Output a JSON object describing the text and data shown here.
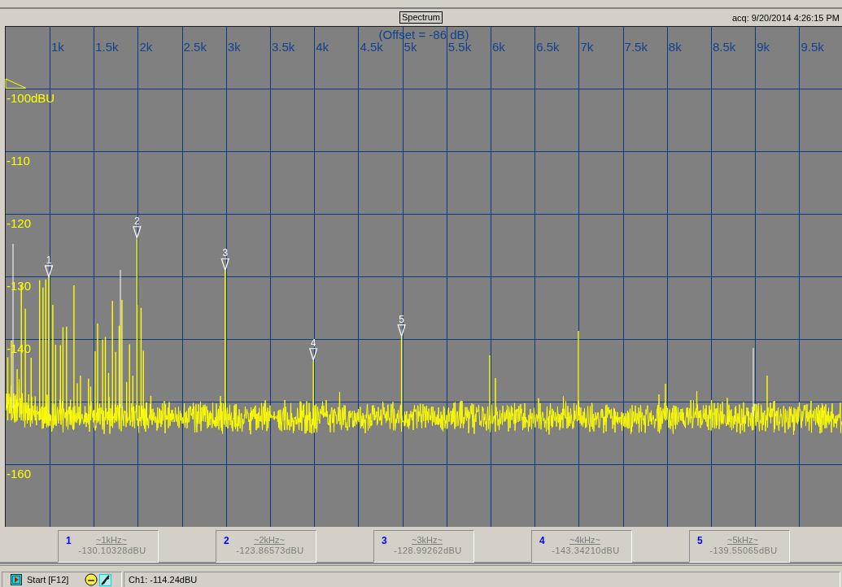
{
  "header": {
    "title": "Spectrum",
    "acquired": "acq: 9/20/2014 4:26:15 PM"
  },
  "plot": {
    "offset": "(Offset = -86 dB)",
    "x_ticks": [
      "1k",
      "1.5k",
      "2k",
      "2.5k",
      "3k",
      "3.5k",
      "4k",
      "4.5k",
      "5k",
      "5.5k",
      "6k",
      "6.5k",
      "7k",
      "7.5k",
      "8k",
      "8.5k",
      "9k",
      "9.5k"
    ],
    "y_ticks": [
      "-100dBU",
      "-110",
      "-120",
      "-130",
      "-140",
      "-160"
    ]
  },
  "markers": [
    {
      "plot_label": "1",
      "number": "1",
      "frequency": "~1kHz~",
      "reading": "-130.10328dBU"
    },
    {
      "plot_label": "2",
      "number": "2",
      "frequency": "~2kHz~",
      "reading": "-123.86573dBU"
    },
    {
      "plot_label": "3",
      "number": "3",
      "frequency": "~3kHz~",
      "reading": "-128.99262dBU"
    },
    {
      "plot_label": "4",
      "number": "4",
      "frequency": "~4kHz~",
      "reading": "-143.34210dBU"
    },
    {
      "plot_label": "5",
      "number": "5",
      "frequency": "~5kHz~",
      "reading": "-139.55065dBU"
    }
  ],
  "status_bar": {
    "start_button": "Start [F12]",
    "readout": "Ch1: -114.24dBU"
  }
}
